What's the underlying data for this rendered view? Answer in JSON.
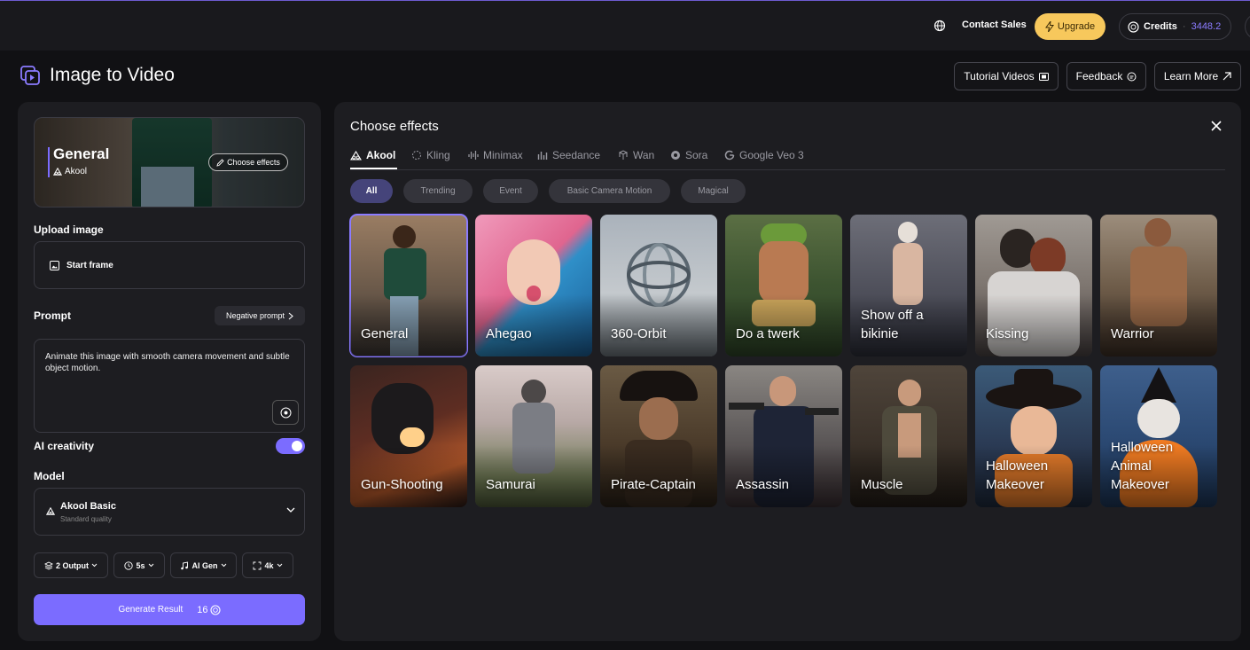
{
  "topbar": {
    "contact_sales": "Contact Sales",
    "upgrade": "Upgrade",
    "credits_label": "Credits",
    "credits_value": "3448.2"
  },
  "page": {
    "title": "Image to Video",
    "tutorial": "Tutorial Videos",
    "feedback": "Feedback",
    "learn_more": "Learn More"
  },
  "left": {
    "hero_title": "General",
    "hero_sub": "Akool",
    "choose_effects": "Choose effects",
    "upload_label": "Upload image",
    "start_frame": "Start frame",
    "prompt_label": "Prompt",
    "negative_prompt": "Negative prompt",
    "prompt_text": "Animate this image with smooth camera movement and subtle object motion.",
    "ai_creativity": "AI creativity",
    "ai_creativity_on": true,
    "model_label": "Model",
    "model_name": "Akool Basic",
    "model_quality": "Standard quality",
    "options": [
      "2 Output",
      "5s",
      "AI Gen",
      "4k"
    ],
    "generate": "Generate Result",
    "cost": "16"
  },
  "effects": {
    "title": "Choose effects",
    "tabs": [
      "Akool",
      "Kling",
      "Minimax",
      "Seedance",
      "Wan",
      "Sora",
      "Google Veo 3"
    ],
    "active_tab": "Akool",
    "chips": [
      "All",
      "Trending",
      "Event",
      "Basic Camera Motion",
      "Magical"
    ],
    "active_chip": "All",
    "row1": [
      "General",
      "Ahegao",
      "360-Orbit",
      "Do a twerk",
      "Show off a bikinie",
      "Kissing",
      "Warrior"
    ],
    "row2": [
      "Gun-Shooting",
      "Samurai",
      "Pirate-Captain",
      "Assassin",
      "Muscle",
      "Halloween Makeover",
      "Halloween Animal Makeover"
    ],
    "selected": "General"
  },
  "colors": {
    "accent": "#7b6cff",
    "upgrade": "#f7c85c",
    "panel": "#1d1d21",
    "background": "#111114"
  }
}
